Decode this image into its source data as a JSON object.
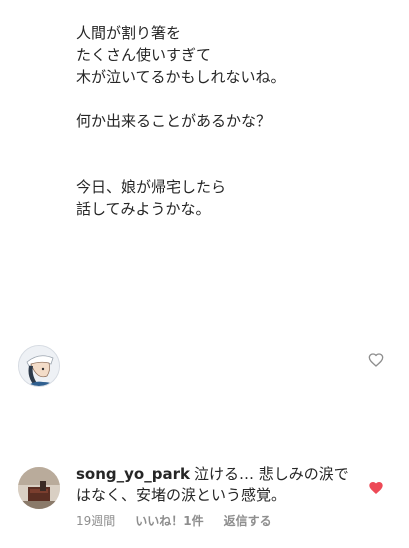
{
  "post": {
    "paragraph_1": "人間が割り箸を\nたくさん使いすぎて\n木が泣いてるかもしれないね。",
    "paragraph_2": "何か出来ることがあるかな？",
    "paragraph_3": "今日、娘が帰宅したら\n話してみようかな。"
  },
  "comment": {
    "username": "song_yo_park",
    "text": "泣ける… 悲しみの涙ではなく、安堵の涙という感覚。",
    "time": "19週間",
    "likes": "いいね！1件",
    "reply": "返信する"
  },
  "colors": {
    "text": "#262626",
    "muted": "#8e8e8e",
    "like_active": "#ed4956"
  },
  "icons": {
    "heart_empty": "heart-outline-icon",
    "heart_filled": "heart-filled-icon"
  }
}
